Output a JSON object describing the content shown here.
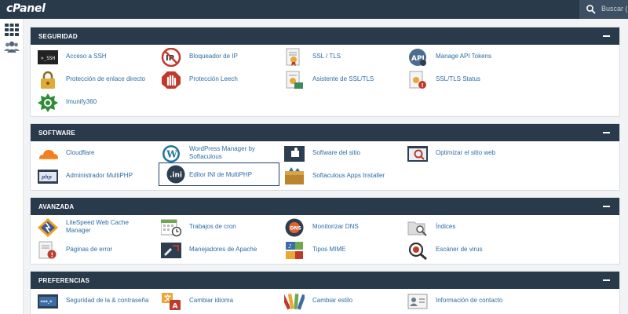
{
  "header": {
    "logo": "cPanel",
    "search_placeholder": "Buscar ("
  },
  "rail": {
    "items": [
      {
        "icon": "grid-icon"
      },
      {
        "icon": "users-icon"
      }
    ]
  },
  "sections": [
    {
      "title": "SEGURIDAD",
      "items": [
        {
          "label": "Acceso a SSH",
          "icon": "terminal-icon"
        },
        {
          "label": "Bloqueador de IP",
          "icon": "ip-blocker-icon"
        },
        {
          "label": "SSL / TLS",
          "icon": "certificate-icon"
        },
        {
          "label": "Manage API Tokens",
          "icon": "api-icon"
        },
        {
          "label": "Protección de enlace directo",
          "icon": "lock-icon"
        },
        {
          "label": "Protección Leech",
          "icon": "hand-stop-icon"
        },
        {
          "label": "Asistente de SSL/TLS",
          "icon": "certificate-wizard-icon"
        },
        {
          "label": "SSL/TLS Status",
          "icon": "certificate-status-icon"
        },
        {
          "label": "Imunify360",
          "icon": "imunify-icon"
        }
      ]
    },
    {
      "title": "SOFTWARE",
      "items": [
        {
          "label": "Cloudflare",
          "icon": "cloud-icon"
        },
        {
          "label": "WordPress Manager by Softaculous",
          "icon": "wordpress-icon"
        },
        {
          "label": "Software del sitio",
          "icon": "puzzle-icon"
        },
        {
          "label": "Optimizar el sitio web",
          "icon": "optimize-icon"
        },
        {
          "label": "Administrador MultiPHP",
          "icon": "php-icon"
        },
        {
          "label": "Editor INI de MultiPHP",
          "icon": "ini-icon"
        },
        {
          "label": "Softaculous Apps Installer",
          "icon": "softaculous-icon"
        }
      ]
    },
    {
      "title": "AVANZADA",
      "items": [
        {
          "label": "LiteSpeed Web Cache Manager",
          "icon": "litespeed-icon"
        },
        {
          "label": "Trabajos de cron",
          "icon": "calendar-clock-icon"
        },
        {
          "label": "Monitorizar DNS",
          "icon": "dns-icon"
        },
        {
          "label": "Índices",
          "icon": "folder-search-icon"
        },
        {
          "label": "Páginas de error",
          "icon": "error-page-icon"
        },
        {
          "label": "Manejadores de Apache",
          "icon": "apache-handler-icon"
        },
        {
          "label": "Tipos MIME",
          "icon": "mime-icon"
        },
        {
          "label": "Escáner de virus",
          "icon": "virus-scan-icon"
        }
      ]
    },
    {
      "title": "PREFERENCIAS",
      "items": [
        {
          "label": "Seguridad de la & contraseña",
          "icon": "password-icon"
        },
        {
          "label": "Cambiar idioma",
          "icon": "language-icon"
        },
        {
          "label": "Cambiar estilo",
          "icon": "palette-icon"
        },
        {
          "label": "Información de contacto",
          "icon": "contact-card-icon"
        }
      ]
    }
  ]
}
